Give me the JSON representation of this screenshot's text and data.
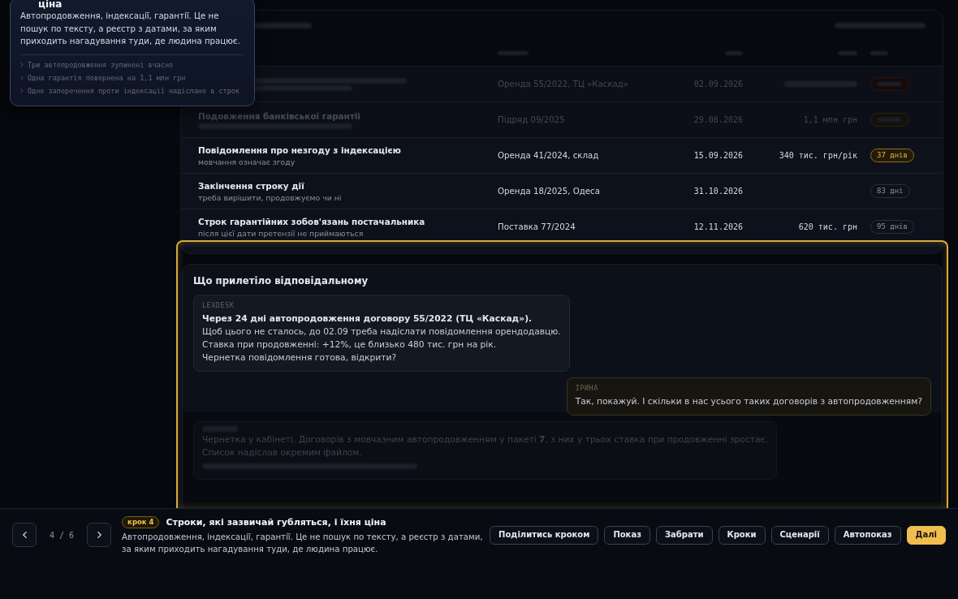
{
  "tour_card": {
    "title": "ціна",
    "body": "Автопродовження, індексації, гарантії. Це не пошук по тексту, а реєстр з датами, за яким приходить нагадування туди, де людина працює.",
    "points": [
      "Три автопродовження зупинені вчасно",
      "Одна гарантія повернена на 1,1 млн грн",
      "Одне заперечення проти індексації надіслане в строк"
    ]
  },
  "register": {
    "toolbar": [
      {
        "blurred": true
      },
      {
        "blurred": true
      }
    ],
    "columns": [
      {
        "blurred": true
      },
      {
        "blurred": true
      },
      {
        "blurred": true
      },
      {
        "blurred": true
      }
    ],
    "rows": [
      {
        "dimmed": true,
        "title": {
          "blurred": true
        },
        "subtitle": {
          "blurred": true
        },
        "contract": "Оренда 55/2022, ТЦ «Каскад»",
        "date": "02.09.2026",
        "sum": {
          "blurred": true
        },
        "badge": {
          "kind": "danger",
          "blurred": true
        }
      },
      {
        "dimmed": true,
        "title": "Подовження банківської гарантії",
        "subtitle": {
          "blurred": true
        },
        "contract": "Підряд 09/2025",
        "date": "29.08.2026",
        "sum": "1,1 млн грн",
        "badge": {
          "kind": "warning",
          "blurred": true
        }
      },
      {
        "dimmed": false,
        "title": "Повідомлення про незгоду з індексацією",
        "subtitle": "мовчання означає згоду",
        "contract": "Оренда 41/2024, склад",
        "date": "15.09.2026",
        "sum": "340 тис. грн/рік",
        "badge": {
          "kind": "warning",
          "label": "37 днів"
        }
      },
      {
        "dimmed": false,
        "title": "Закінчення строку дії",
        "subtitle": "треба вирішити, продовжуємо чи ні",
        "contract": "Оренда 18/2025, Одеса",
        "date": "31.10.2026",
        "badge": {
          "kind": "neutral",
          "label": "83 дні"
        }
      },
      {
        "dimmed": false,
        "title": "Строк гарантійних зобов'язань постачальника",
        "subtitle": "після цієї дати претензії не приймаються",
        "contract": "Поставка 77/2024",
        "date": "12.11.2026",
        "sum": "620 тис. грн",
        "badge": {
          "kind": "neutral",
          "label": "95 днів"
        }
      }
    ]
  },
  "chat": {
    "title": "Що прилетіло відповідальному",
    "messages": [
      {
        "kind": "bot",
        "dimmed": false,
        "author": "LEXDESK",
        "heading": "Через 24 дні автопродовження договору 55/2022 (ТЦ «Каскад»).",
        "lines": [
          "Щоб цього не сталось, до 02.09 треба надіслати повідомлення орендодавцю.",
          "Ставка при продовженні: +12%, це близько 480 тис. грн на рік.",
          "Чернетка повідомлення готова, відкрити?"
        ]
      },
      {
        "kind": "user",
        "dimmed": false,
        "author": "ІРИНА",
        "lines": [
          "Так, покажуй. І скільки в нас усього таких договорів з автопродовженням?"
        ]
      },
      {
        "kind": "bot",
        "dimmed": true,
        "author": {
          "blurred": true
        },
        "lines": [
          "Чернетка у кабінеті. Договорів з мовчазним автопродовженням у пакеті **7**, з них у трьох ставка при продовженні зростає.",
          "Список надіслав окремим файлом.",
          {
            "blurred": true
          }
        ]
      }
    ]
  },
  "tour_bar": {
    "counter": "4 / 6",
    "step": "крок 4",
    "title": "Строки, які зазвичай губляться, і їхня ціна",
    "description": "Автопродовження, індексації, гарантії. Це не пошук по тексту, а реєстр з датами, за яким приходить нагадування туди, де людина працює.",
    "actions": [
      {
        "label": "Поділитись кроком",
        "kind": "secondary"
      },
      {
        "label": "Показ",
        "kind": "secondary"
      },
      {
        "label": "Забрати",
        "kind": "secondary"
      },
      {
        "label": "Кроки",
        "kind": "secondary"
      },
      {
        "label": "Сценарії",
        "kind": "secondary"
      },
      {
        "label": "Автопоказ",
        "kind": "secondary"
      },
      {
        "label": "Далі",
        "kind": "primary"
      }
    ]
  }
}
